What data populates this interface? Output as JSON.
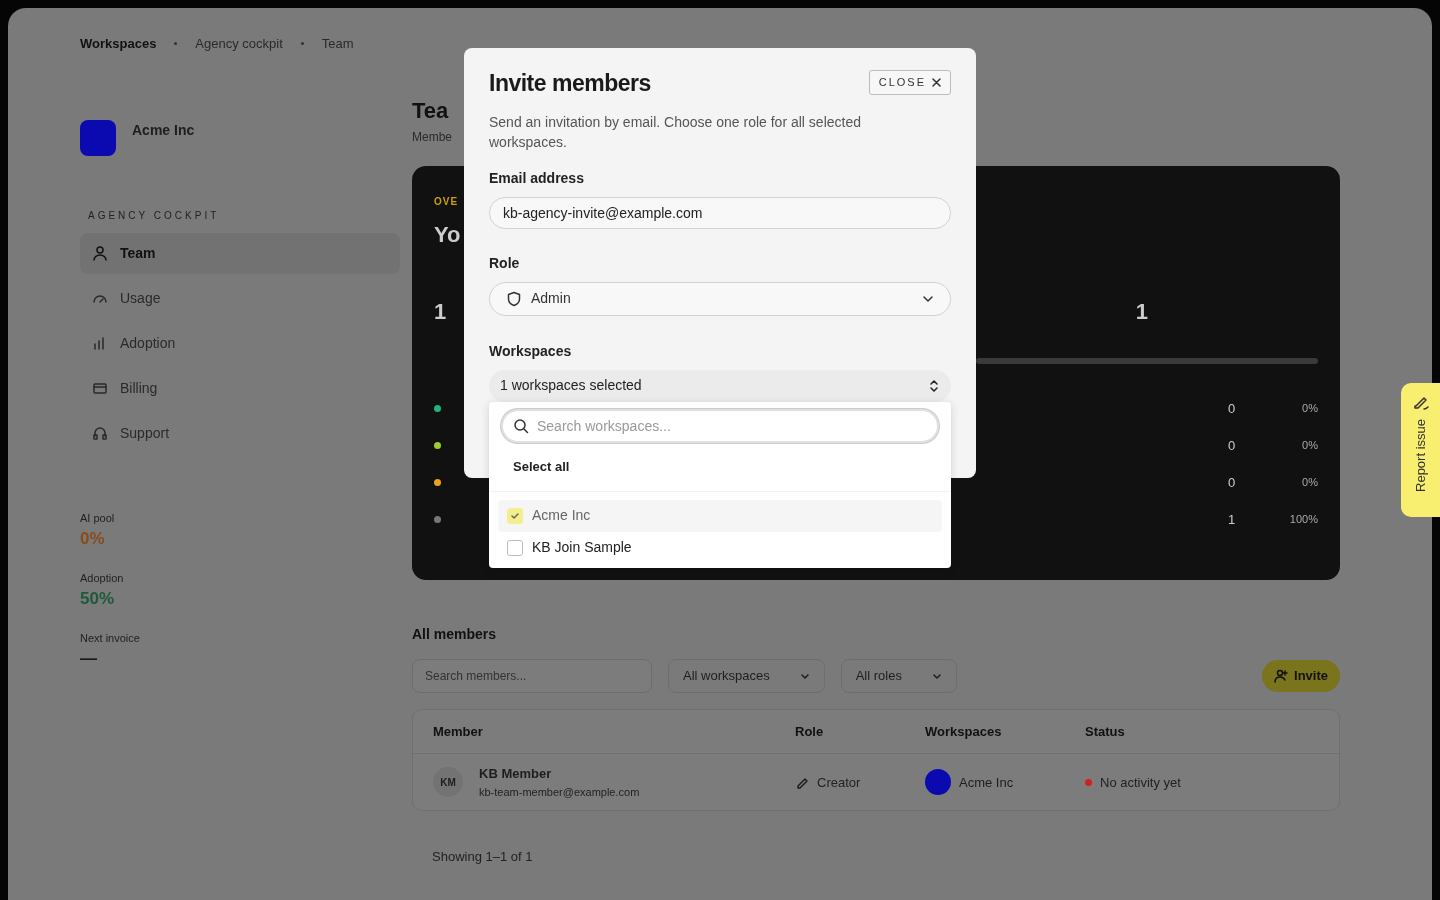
{
  "breadcrumb": [
    {
      "label": "Workspaces"
    },
    {
      "label": "Agency cockpit"
    },
    {
      "label": "Team"
    }
  ],
  "sidebar": {
    "org": {
      "name": "Acme Inc"
    },
    "section": "AGENCY COCKPIT",
    "items": [
      {
        "label": "Team",
        "selected": true
      },
      {
        "label": "Usage",
        "selected": false
      },
      {
        "label": "Adoption",
        "selected": false
      },
      {
        "label": "Billing",
        "selected": false
      },
      {
        "label": "Support",
        "selected": false
      }
    ],
    "stats": [
      {
        "label": "AI pool",
        "value": "0%",
        "color": "#8a4a1c"
      },
      {
        "label": "Adoption",
        "value": "50%",
        "color": "#1d5a3a"
      },
      {
        "label": "Next invoice",
        "value": "—",
        "color": "#1a1a1a"
      }
    ]
  },
  "page": {
    "title": "Tea",
    "subtitle": "Membe"
  },
  "overview": {
    "eyebrow": "OVE",
    "heading": "Yo",
    "stats": [
      {
        "value": "1"
      },
      {
        "value": "1"
      }
    ],
    "rows": [
      {
        "color": "#1fb57a",
        "count": "0",
        "share": "0%"
      },
      {
        "color": "#9acd32",
        "count": "0",
        "share": "0%"
      },
      {
        "color": "#f0a020",
        "count": "0",
        "share": "0%"
      },
      {
        "color": "#777777",
        "count": "1",
        "share": "100%"
      }
    ]
  },
  "members": {
    "title": "All members",
    "search": {
      "placeholder": "Search members..."
    },
    "filters": [
      "All workspaces",
      "All roles"
    ],
    "invite": "Invite",
    "columns": [
      "Member",
      "Role",
      "Workspaces",
      "Status"
    ],
    "rows": [
      {
        "initials": "KM",
        "name": "KB Member",
        "email": "kb-team-member@example.com",
        "role": "Creator",
        "workspace": "Acme Inc",
        "status": "No activity yet"
      }
    ],
    "footer": "Showing 1–1 of 1"
  },
  "modal": {
    "title": "Invite members",
    "close": "CLOSE",
    "description": "Send an invitation by email. Choose one role for all selected workspaces.",
    "email": {
      "label": "Email address",
      "value": "kb-agency-invite@example.com"
    },
    "role": {
      "label": "Role",
      "value": "Admin"
    },
    "workspaces": {
      "label": "Workspaces",
      "summary": "1 workspaces selected",
      "search": {
        "placeholder": "Search workspaces..."
      },
      "select_all": "Select all",
      "options": [
        {
          "label": "Acme Inc",
          "checked": true
        },
        {
          "label": "KB Join Sample",
          "checked": false
        }
      ]
    }
  },
  "report_button": {
    "label": "Report issue"
  }
}
